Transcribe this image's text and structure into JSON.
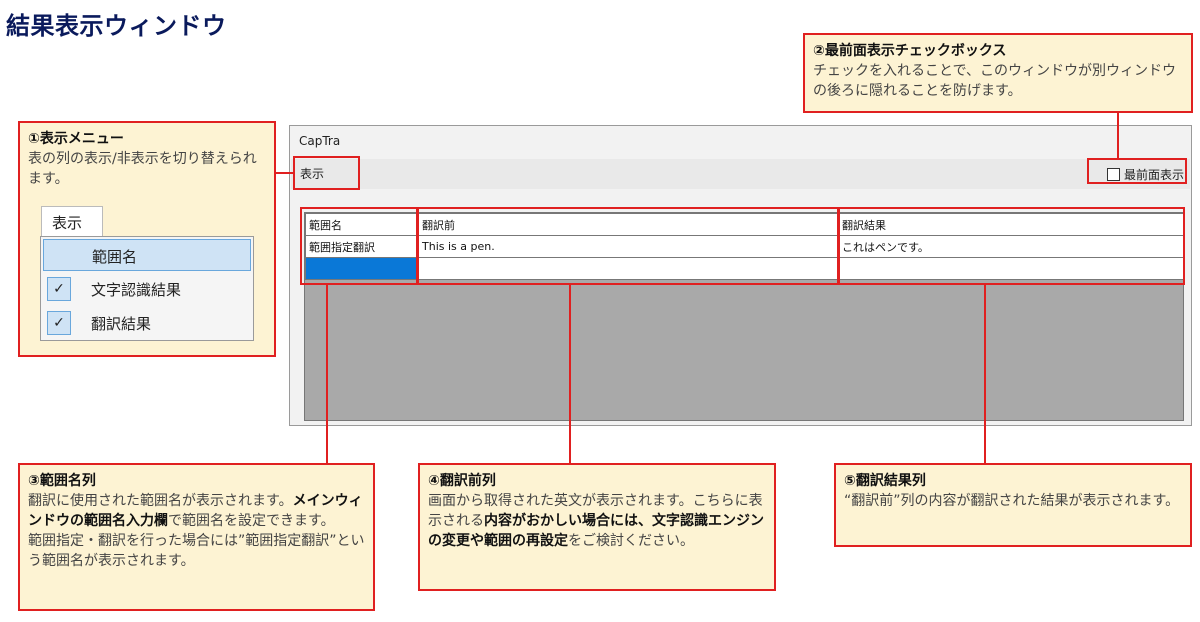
{
  "page_title": "結果表示ウィンドウ",
  "app": {
    "title": "CapTra",
    "menu_label": "表示",
    "topmost_label": "最前面表示",
    "columns": [
      "範囲名",
      "翻訳前",
      "翻訳結果"
    ],
    "rows": [
      [
        "範囲指定翻訳",
        "This is a pen.",
        "これはペンです。"
      ],
      [
        "",
        "",
        ""
      ]
    ]
  },
  "mini_menu": {
    "tab_label": "表示",
    "items": [
      {
        "label": "範囲名",
        "checked": false
      },
      {
        "label": "文字認識結果",
        "checked": true
      },
      {
        "label": "翻訳結果",
        "checked": true
      }
    ],
    "check_glyph": "✓"
  },
  "callouts": {
    "c1": {
      "title": "①表示メニュー",
      "body": "表の列の表示/非表示を切り替えられます。"
    },
    "c2": {
      "title": "②最前面表示チェックボックス",
      "body": "チェックを入れることで、このウィンドウが別ウィンドウの後ろに隠れることを防げます。"
    },
    "c3": {
      "title": "③範囲名列",
      "body1": "翻訳に使用された範囲名が表示されます。",
      "bold": "メインウィンドウの範囲名入力欄",
      "body2": "で範囲名を設定できます。",
      "body3": "範囲指定・翻訳を行った場合には”範囲指定翻訳”という範囲名が表示されます。"
    },
    "c4": {
      "title": "④翻訳前列",
      "body1": "画面から取得された英文が表示されます。こちらに表示される",
      "bold": "内容がおかしい場合には、文字認識エンジンの変更や範囲の再設定",
      "body2": "をご検討ください。"
    },
    "c5": {
      "title": "⑤翻訳結果列",
      "body": "“翻訳前”列の内容が翻訳された結果が表示されます。"
    }
  },
  "colors": {
    "accent_red": "#e02020",
    "callout_bg": "#fdf3d3",
    "title_navy": "#0a1a5c",
    "selection_blue": "#0a78d7"
  }
}
